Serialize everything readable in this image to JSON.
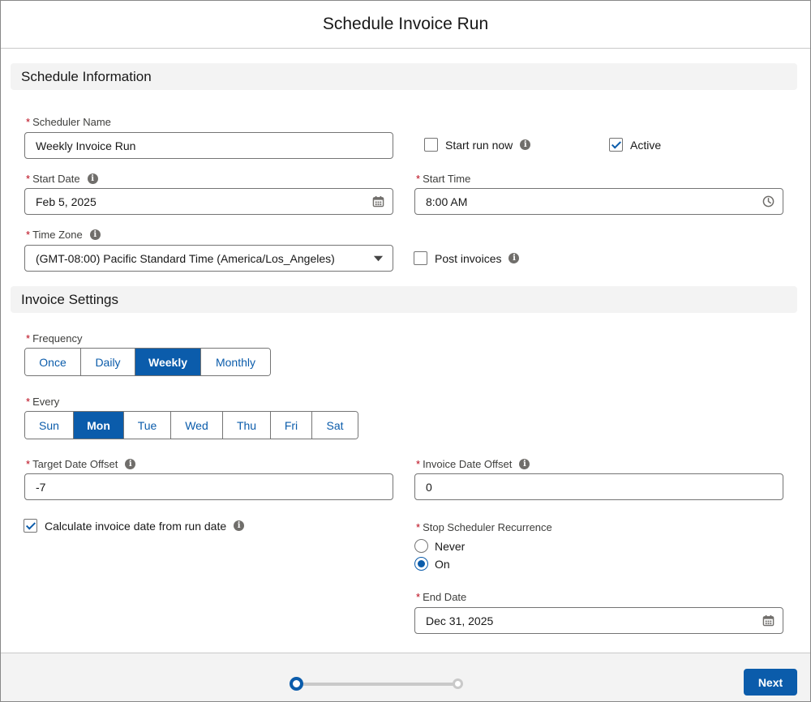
{
  "modal": {
    "title": "Schedule Invoice Run"
  },
  "sections": {
    "schedule_info": "Schedule Information",
    "invoice_settings": "Invoice Settings"
  },
  "fields": {
    "scheduler_name": {
      "label": "Scheduler Name",
      "value": "Weekly Invoice Run"
    },
    "start_run_now": {
      "label": "Start run now",
      "checked": false
    },
    "active": {
      "label": "Active",
      "checked": true
    },
    "start_date": {
      "label": "Start Date",
      "value": "Feb 5, 2025"
    },
    "start_time": {
      "label": "Start Time",
      "value": "8:00 AM"
    },
    "time_zone": {
      "label": "Time Zone",
      "value": "(GMT-08:00) Pacific Standard Time (America/Los_Angeles)"
    },
    "post_invoices": {
      "label": "Post invoices",
      "checked": false
    },
    "frequency": {
      "label": "Frequency",
      "options": [
        "Once",
        "Daily",
        "Weekly",
        "Monthly"
      ],
      "selected": "Weekly"
    },
    "every": {
      "label": "Every",
      "options": [
        "Sun",
        "Mon",
        "Tue",
        "Wed",
        "Thu",
        "Fri",
        "Sat"
      ],
      "selected": "Mon"
    },
    "target_date_offset": {
      "label": "Target Date Offset",
      "value": "-7"
    },
    "invoice_date_offset": {
      "label": "Invoice Date Offset",
      "value": "0"
    },
    "calc_invoice_date": {
      "label": "Calculate invoice date from run date",
      "checked": true
    },
    "stop_recurrence": {
      "label": "Stop Scheduler Recurrence",
      "options": [
        "Never",
        "On"
      ],
      "selected": "On"
    },
    "end_date": {
      "label": "End Date",
      "value": "Dec 31, 2025"
    }
  },
  "footer": {
    "next_label": "Next",
    "current_step": 1,
    "total_steps": 2
  },
  "colors": {
    "brand": "#0b5cab",
    "required": "#ba0517",
    "section_bg": "#f3f3f3"
  },
  "icons": {
    "info": "info-icon",
    "calendar": "calendar-icon",
    "clock": "clock-icon",
    "dropdown": "chevron-down-icon"
  }
}
